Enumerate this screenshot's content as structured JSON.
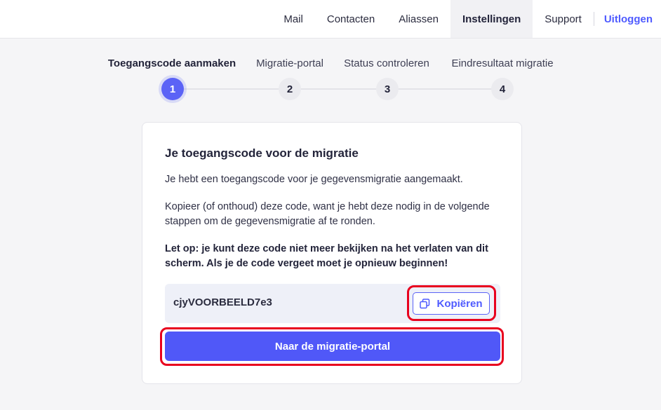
{
  "nav": {
    "items": [
      {
        "label": "Mail",
        "name": "nav-mail"
      },
      {
        "label": "Contacten",
        "name": "nav-contacten"
      },
      {
        "label": "Aliassen",
        "name": "nav-aliassen"
      },
      {
        "label": "Instellingen",
        "name": "nav-instellingen",
        "active": true
      },
      {
        "label": "Support",
        "name": "nav-support"
      }
    ],
    "logout": "Uitloggen"
  },
  "stepper": {
    "steps": [
      {
        "label": "Toegangscode aanmaken",
        "number": "1",
        "active": true
      },
      {
        "label": "Migratie-portal",
        "number": "2"
      },
      {
        "label": "Status controleren",
        "number": "3"
      },
      {
        "label": "Eindresultaat migratie",
        "number": "4"
      }
    ]
  },
  "card": {
    "title": "Je toegangscode voor de migratie",
    "p1": "Je hebt een toegangscode voor je gegevensmigratie aangemaakt.",
    "p2": "Kopieer (of onthoud) deze code, want je hebt deze nodig in de volgende stappen om de gegevensmigratie af te ronden.",
    "warning": "Let op: je kunt deze code niet meer bekijken na het verlaten van dit scherm. Als je de code vergeet moet je opnieuw beginnen!",
    "code": "cjyVOORBEELD7e3",
    "copy_label": "Kopiëren",
    "primary_label": "Naar de migratie-portal"
  },
  "colors": {
    "accent": "#5058f8",
    "link": "#4f5bff",
    "highlight": "#e8001e",
    "background": "#f5f5f7"
  }
}
